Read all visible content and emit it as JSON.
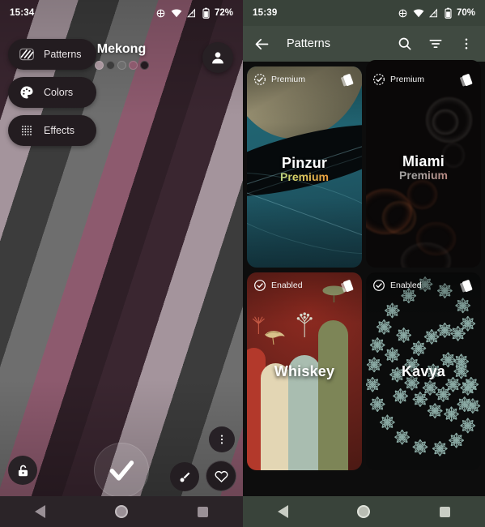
{
  "left_panel": {
    "status_bar": {
      "time": "15:34",
      "battery": "72%",
      "icons": [
        "location-icon",
        "wifi-icon",
        "signal-warning-icon",
        "battery-icon"
      ]
    },
    "chips": [
      {
        "label": "Patterns",
        "icon": "patterns-icon"
      },
      {
        "label": "Colors",
        "icon": "palette-icon"
      },
      {
        "label": "Effects",
        "icon": "effects-dots-icon"
      }
    ],
    "wallpaper_title": "Mekong",
    "palette_dots": [
      "#a9969e",
      "#3c3c3c",
      "#6e6e6e",
      "#8d5a6e",
      "#241a20"
    ],
    "avatar_icon": "account-icon",
    "controls": {
      "lock_icon": "unlock-icon",
      "apply_icon": "check-icon",
      "more_icon": "more-vertical-icon",
      "brush_icon": "brush-icon",
      "favorite_icon": "heart-icon"
    },
    "nav_bar": {
      "back": "back-triangle-icon",
      "home": "home-circle-icon",
      "recents": "recents-square-icon"
    },
    "stripe_colors": [
      "#3a2630",
      "#a4949c",
      "#3c3c3c",
      "#6e6e6e",
      "#8d5a6e",
      "#2f1f27"
    ]
  },
  "right_panel": {
    "status_bar": {
      "time": "15:39",
      "battery": "70%",
      "icons": [
        "location-icon",
        "wifi-icon",
        "signal-warning-icon",
        "battery-icon"
      ]
    },
    "app_bar": {
      "back_icon": "arrow-back-icon",
      "title": "Patterns",
      "search_icon": "search-icon",
      "filter_icon": "filter-icon",
      "overflow_icon": "more-vertical-icon"
    },
    "cards": [
      {
        "name": "Pinzur",
        "subtitle": "Premium",
        "badge": "Premium",
        "badge_icon": "check-circle-icon",
        "stack_icon": "layers-icon",
        "accent": "#1f6b78"
      },
      {
        "name": "Miami",
        "subtitle": "Premium",
        "badge": "Premium",
        "badge_icon": "check-circle-icon",
        "stack_icon": "layers-icon",
        "accent": "#c96a5c"
      },
      {
        "name": "Whiskey",
        "subtitle": "",
        "badge": "Enabled",
        "badge_icon": "check-circle-icon",
        "stack_icon": "layers-icon",
        "accent": "#8e2a20"
      },
      {
        "name": "Kavya",
        "subtitle": "",
        "badge": "Enabled",
        "badge_icon": "check-circle-icon",
        "stack_icon": "layers-icon",
        "accent": "#7fa9a6"
      }
    ],
    "nav_bar": {
      "back": "back-triangle-icon",
      "home": "home-circle-icon",
      "recents": "recents-square-icon"
    },
    "background_color": "#39433a"
  }
}
